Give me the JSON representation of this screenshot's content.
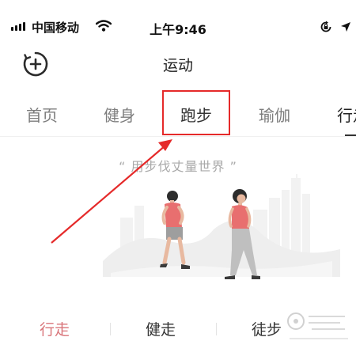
{
  "status_bar": {
    "carrier": "中国移动",
    "time": "上午9:46",
    "icons": [
      "signal-icon",
      "wifi-icon",
      "rotation-lock-icon",
      "location-arrow-icon"
    ]
  },
  "header": {
    "title": "运动",
    "add_icon": "circle-plus-icon"
  },
  "tabs": [
    {
      "label": "首页"
    },
    {
      "label": "健身"
    },
    {
      "label": "跑步"
    },
    {
      "label": "瑜伽"
    },
    {
      "label": "行走"
    }
  ],
  "slogan": "“ 用步伐丈量世界 ”",
  "mode_tabs": [
    {
      "label": "行走",
      "active": true
    },
    {
      "label": "健走",
      "active": false
    },
    {
      "label": "徒步",
      "active": false
    }
  ],
  "colors": {
    "annotation_red": "#e52a2a",
    "active_mode": "#d9757a",
    "tab_inactive": "#7d7d7d"
  }
}
